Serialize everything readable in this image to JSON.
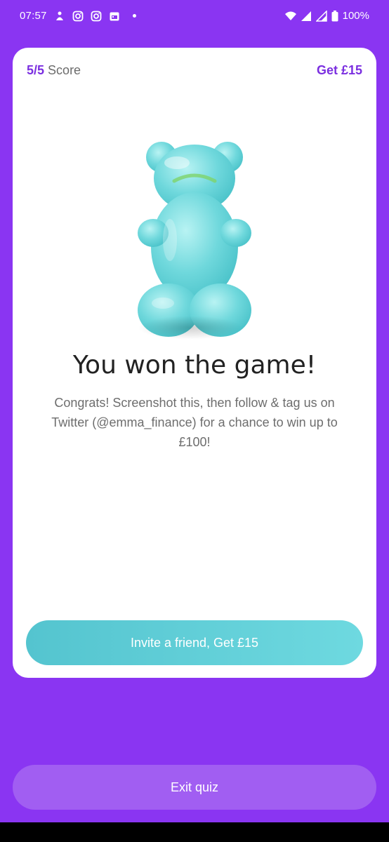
{
  "status_bar": {
    "time": "07:57",
    "battery": "100%",
    "icons": [
      "notification-icon",
      "instagram-icon",
      "instagram-icon",
      "calendar-icon",
      "wifi-icon",
      "signal-icon",
      "battery-icon"
    ]
  },
  "card": {
    "score_value": "5/5",
    "score_label": "Score",
    "get_label": "Get £15",
    "title": "You won the game!",
    "message": "Congrats! Screenshot this, then follow & tag us on Twitter (@emma_finance) for a chance to win up to  £100!",
    "invite_button": "Invite a friend, Get £15"
  },
  "exit_button": "Exit quiz",
  "colors": {
    "background": "#8a35f2",
    "accent": "#7b2fe0",
    "invite_button": "#5fd0d8",
    "exit_button": "#a15ef2",
    "bear": "#6fd8dc"
  }
}
